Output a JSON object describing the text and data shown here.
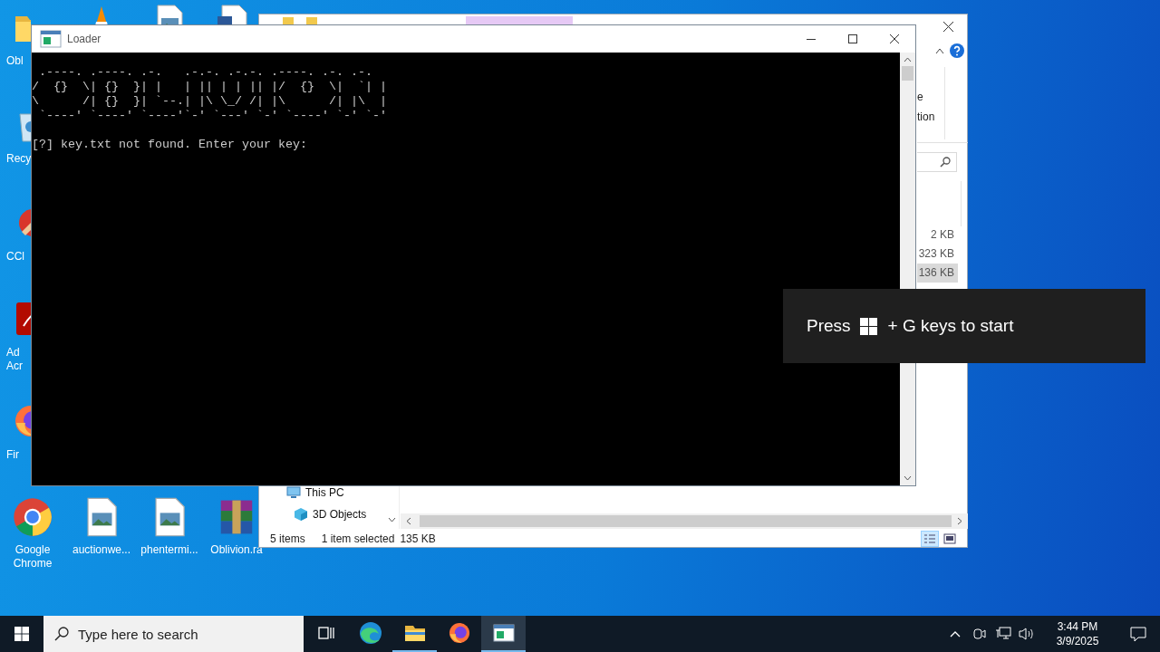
{
  "desktop_icons": [
    {
      "kind": "folder",
      "label": "Obl"
    },
    {
      "kind": "recycle-bin",
      "label": "Recy"
    },
    {
      "kind": "brush",
      "label": "CCl"
    },
    {
      "kind": "pdf",
      "label": "Ad\nAcr"
    },
    {
      "kind": "firefox",
      "label": "Fir"
    },
    {
      "kind": "chrome",
      "label": "Google\nChrome"
    },
    {
      "kind": "image-file",
      "label": "auctionwe..."
    },
    {
      "kind": "image-file",
      "label": "phentermi..."
    },
    {
      "kind": "archive",
      "label": "Oblivion.ra"
    }
  ],
  "top_icons": [
    {
      "kind": "cone"
    },
    {
      "kind": "image-file"
    },
    {
      "kind": "doc-file"
    }
  ],
  "explorer": {
    "ribbon_texts": [
      "e",
      "tion"
    ],
    "sizes": [
      {
        "text": "2 KB",
        "selected": false
      },
      {
        "text": "323 KB",
        "selected": false
      },
      {
        "text": "136 KB",
        "selected": true
      }
    ],
    "nav_items": [
      {
        "kind": "pc",
        "label": "This PC"
      },
      {
        "kind": "cube",
        "label": "3D Objects"
      }
    ],
    "status": [
      "5 items",
      "1 item selected",
      "135 KB"
    ],
    "views": [
      {
        "kind": "details",
        "selected": true
      },
      {
        "kind": "tiles",
        "selected": false
      }
    ]
  },
  "console": {
    "title": "Loader",
    "ascii_art": [
      " .----. .----. .-.   .-.-. .-.-. .----. .-. .-.",
      "/  {}  \\| {}  }| |   | || | | || |/  {}  \\|  `| |",
      "\\      /| {}  }| `--.| |\\ \\_/ /| |\\      /| |\\  |",
      " `----' `----' `----'`-' `---' `-' `----' `-' `-'"
    ],
    "lines": [
      "[?] key.txt not found. Enter your key:"
    ]
  },
  "toast": {
    "before": "Press",
    "after": "+ G keys to start"
  },
  "taskbar": {
    "search_placeholder": "Type here to search",
    "apps": [
      {
        "kind": "task-view",
        "active": false
      },
      {
        "kind": "edge",
        "active": false
      },
      {
        "kind": "explorer",
        "active": true
      },
      {
        "kind": "firefox",
        "active": false
      },
      {
        "kind": "console",
        "active": true
      }
    ],
    "time": "3:44 PM",
    "date": "3/9/2025"
  }
}
